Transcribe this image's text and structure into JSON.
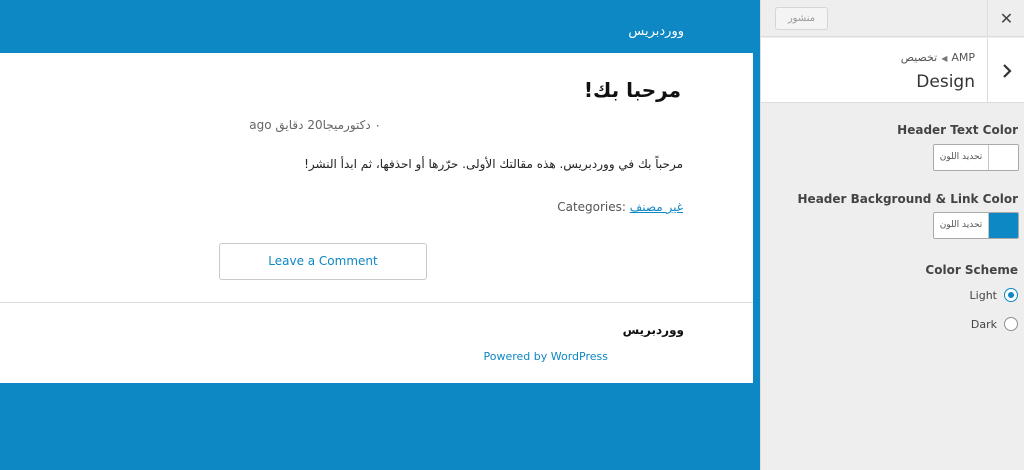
{
  "preview": {
    "site_title": "ووردبريس",
    "post": {
      "title": "مرحبا بك!",
      "meta": "٠ دكتورميجا20 دقايق ago",
      "body": "مرحباً بك في ووردبريس. هذه مقالتك الأولى. حرّرها أو احذفها، ثم ابدأ النشر!",
      "categories_label": "Categories:",
      "category_link": "غير مصنف"
    },
    "comment_button": "Leave a Comment",
    "footer": {
      "site_title": "ووردبريس",
      "powered_by": "Powered by WordPress"
    },
    "colors": {
      "brand": "#0e87c5"
    }
  },
  "panel": {
    "publish_label": "منشور",
    "close_icon": "close-icon",
    "back_icon": "chevron-right-icon",
    "breadcrumb": {
      "parent": "AMP",
      "current": "تخصيص"
    },
    "section_title": "Design",
    "controls": {
      "header_text_color": {
        "label": "Header Text Color",
        "picker_label": "تحديد اللون",
        "value_color": "#ffffff"
      },
      "header_bg_link_color": {
        "label": "Header Background & Link Color",
        "picker_label": "تحديد اللون",
        "value_color": "#0e87c5"
      },
      "color_scheme": {
        "label": "Color Scheme",
        "options": [
          {
            "label": "Light",
            "selected": true
          },
          {
            "label": "Dark",
            "selected": false
          }
        ]
      }
    }
  }
}
